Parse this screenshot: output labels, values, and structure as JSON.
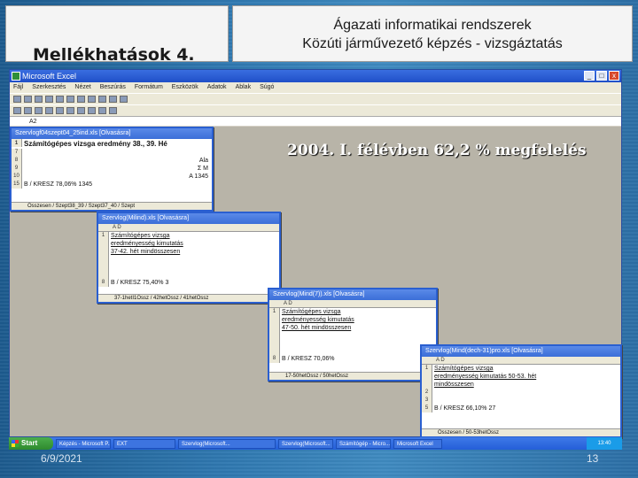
{
  "slide": {
    "section_title": "Mellékhatások 4.",
    "header_line1": "Ágazati informatikai rendszerek",
    "header_line2": "Közúti járművezető képzés - vizsgáztatás",
    "highlight_text": "2004. I. félévben 62,2 % megfelelés",
    "date": "6/9/2021",
    "page_number": "13"
  },
  "excel": {
    "app_title": "Microsoft Excel",
    "menu": [
      "Fájl",
      "Szerkesztés",
      "Nézet",
      "Beszúrás",
      "Formátum",
      "Eszközök",
      "Adatok",
      "Ablak",
      "Súgó"
    ],
    "name_box": "A2",
    "window_buttons": [
      "_",
      "□",
      "x"
    ]
  },
  "windows": [
    {
      "title": "Szervlogf04szept04_25ind.xls [Olvasásra]",
      "rows": [
        {
          "n": "1",
          "text": "Számítógépes vizsga eredmény 38., 39. Hé"
        },
        {
          "n": "7",
          "text": ""
        },
        {
          "n": "8",
          "text": "Ala"
        },
        {
          "n": "9",
          "text": "Σ     M"
        },
        {
          "n": "10",
          "text": "A     1345"
        },
        {
          "n": "15",
          "text": "B / KRESZ       78,06%   1345"
        }
      ],
      "tabs": "Összesen / Szept38_39 / Szept37_40 / Szept"
    },
    {
      "title": "Szervlog(Milind).xls [Olvasásra]",
      "cols": "A                                   D",
      "rows": [
        {
          "n": "1",
          "text": "Számítógépes vizsga"
        },
        {
          "n": "",
          "text": "eredményesség kimutatás"
        },
        {
          "n": "",
          "text": "37-42. hét mindösszesen"
        },
        {
          "n": "",
          "text": ""
        },
        {
          "n": "8",
          "text": "B / KRESZ                 75,40%   3"
        }
      ],
      "tabs": "37-1hetI1Ossz / 42hetOssz / 41hetOssz"
    },
    {
      "title": "Szervlog(Mind(7)).xls [Olvasásra]",
      "cols": "A                                   D",
      "rows": [
        {
          "n": "1",
          "text": "Számítógépes vizsga"
        },
        {
          "n": "",
          "text": "eredményesség kimutatás"
        },
        {
          "n": "",
          "text": "47-50. hét mindösszesen"
        },
        {
          "n": "",
          "text": ""
        },
        {
          "n": "8",
          "text": "B / KRESZ              70,06%"
        }
      ],
      "tabs": "17-50hetOssz / 50hetOssz"
    },
    {
      "title": "Szervlog(Mind(dech-31)pro.xls [Olvasásra]",
      "cols": "A                                               D",
      "rows": [
        {
          "n": "1",
          "text": "Számítógépes vizsga"
        },
        {
          "n": "",
          "text": "eredményesség kimutatás 50-53. hét"
        },
        {
          "n": "",
          "text": "mindösszesen"
        },
        {
          "n": "2",
          "text": ""
        },
        {
          "n": "3",
          "text": ""
        },
        {
          "n": "5",
          "text": "B / KRESZ                          66,10%    27"
        }
      ],
      "tabs": "Összesen / 50-53hetOssz"
    }
  ],
  "taskbar": {
    "start_label": "Start",
    "items": [
      "Képzés - Microsoft P...",
      "EXT",
      "Szervlog(Microsoft...",
      "Szervlog(Microsoft...",
      "Számítógép - Micro...",
      "Microsoft Excel"
    ],
    "tray": "13:40"
  }
}
